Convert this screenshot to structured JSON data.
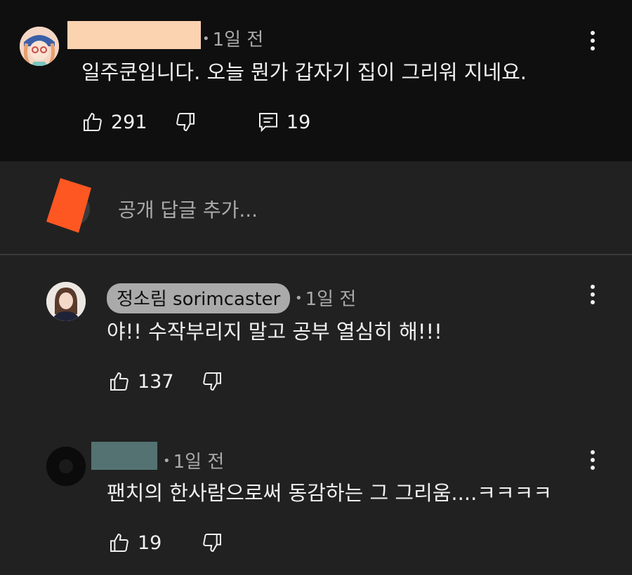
{
  "top_comment": {
    "time": "1일 전",
    "text": "일주쿤입니다. 오늘 뭔가 갑자기 집이 그리워 지네요.",
    "likes": "291",
    "replies": "19"
  },
  "reply_box": {
    "placeholder": "공개 답글 추가..."
  },
  "replies": [
    {
      "author": "정소림 sorimcaster",
      "time": "1일 전",
      "text": "야!! 수작부리지 말고 공부 열심히 해!!!",
      "likes": "137"
    },
    {
      "time": "1일 전",
      "text": "팬치의 한사람으로써 동감하는 그 그리움....ㅋㅋㅋㅋ",
      "likes": "19"
    }
  ],
  "colors": {
    "top_bg": "#0f0f0f",
    "body_bg": "#212121",
    "text": "#f1f1f1",
    "muted": "#aaaaaa"
  },
  "icons": [
    "thumbs-up-icon",
    "thumbs-down-icon",
    "reply-comment-icon",
    "more-vert-icon"
  ]
}
